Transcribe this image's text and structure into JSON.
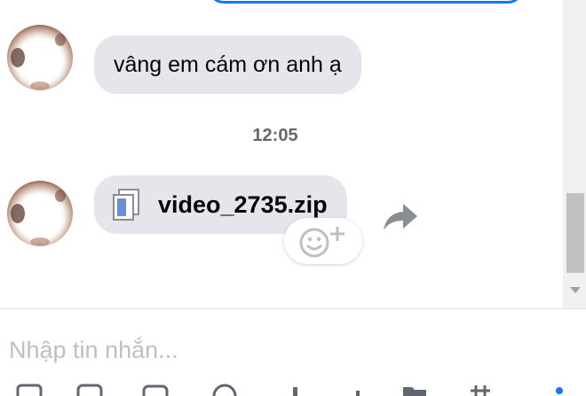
{
  "messages": [
    {
      "type": "text",
      "text": "vâng em cám ơn anh ạ"
    },
    {
      "type": "timestamp",
      "text": "12:05"
    },
    {
      "type": "file",
      "file_name": "video_2735.zip",
      "icon": "file-archive-icon"
    }
  ],
  "composer": {
    "placeholder": "Nhập tin nhắn..."
  },
  "colors": {
    "bubble": "#e4e6eb",
    "accent": "#1877f2",
    "timestamp": "#65676b"
  }
}
